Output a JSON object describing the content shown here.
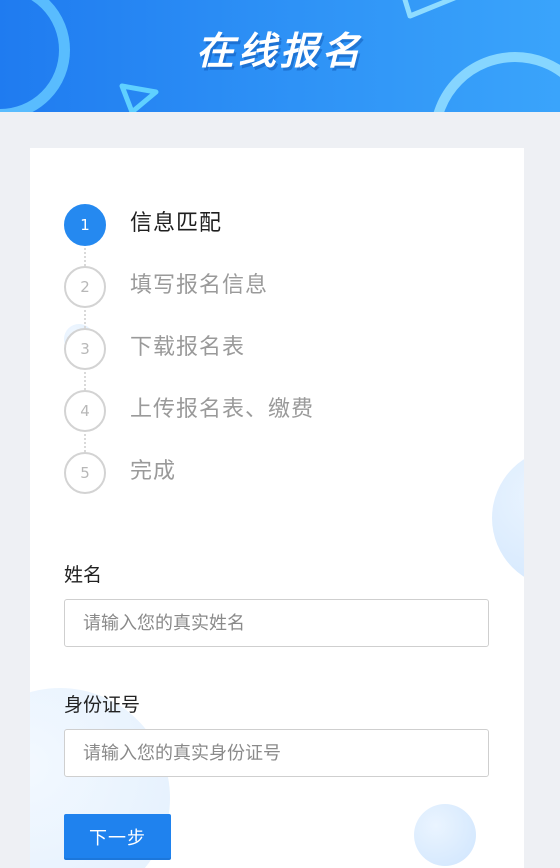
{
  "header": {
    "title": "在线报名"
  },
  "steps": [
    {
      "number": "1",
      "label": "信息匹配",
      "active": true
    },
    {
      "number": "2",
      "label": "填写报名信息",
      "active": false
    },
    {
      "number": "3",
      "label": "下载报名表",
      "active": false
    },
    {
      "number": "4",
      "label": "上传报名表、缴费",
      "active": false
    },
    {
      "number": "5",
      "label": "完成",
      "active": false
    }
  ],
  "form": {
    "name": {
      "label": "姓名",
      "value": "",
      "placeholder": "请输入您的真实姓名"
    },
    "id_number": {
      "label": "身份证号",
      "value": "",
      "placeholder": "请输入您的真实身份证号"
    },
    "next_label": "下一步"
  },
  "colors": {
    "accent": "#2589f0",
    "banner": "#2c8ff5",
    "inactive_step": "#b8b8b8"
  }
}
